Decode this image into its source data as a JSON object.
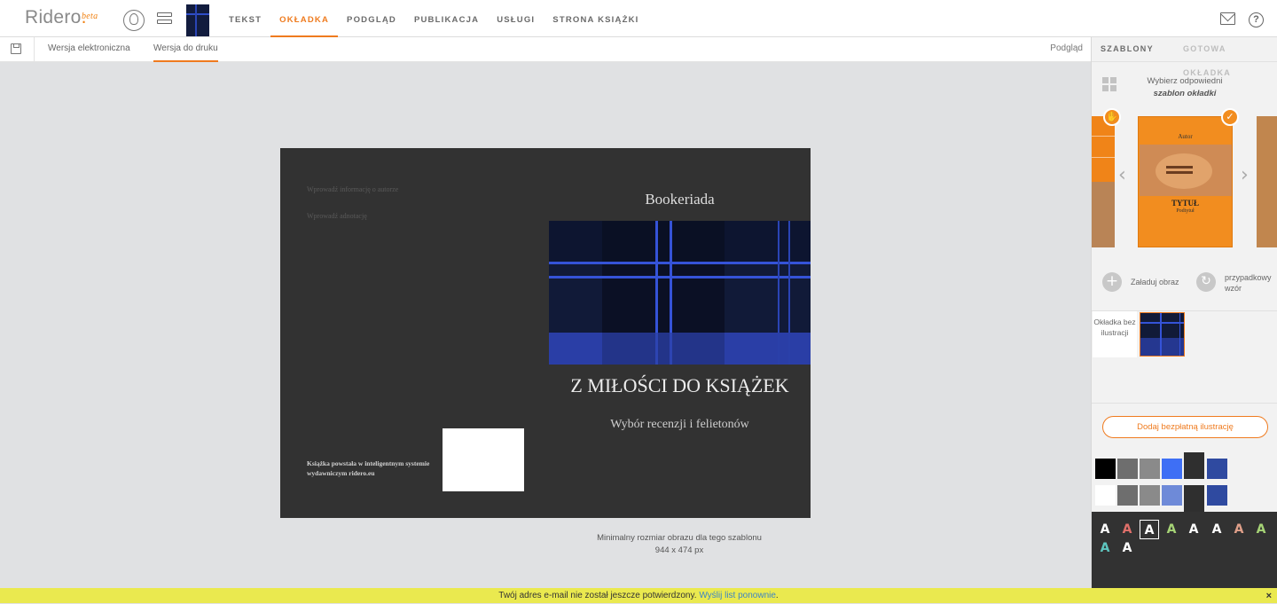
{
  "app": {
    "logo": "Ridero",
    "logo_dot": ".",
    "logo_badge": "beta"
  },
  "nav": {
    "items": [
      "TEKST",
      "OKŁADKA",
      "PODGLĄD",
      "PUBLIKACJA",
      "USŁUGI",
      "STRONA KSIĄŻKI"
    ],
    "active_index": 1
  },
  "subnav": {
    "tabs": [
      "Wersja elektroniczna",
      "Wersja do druku"
    ],
    "active_index": 1,
    "preview": "Podgląd"
  },
  "cover": {
    "author_info": "Wprowadź informację o autorze",
    "annotation": "Wprowadź adnotację",
    "imprint": "Książka powstała w inteligentnym systemie wydawniczym ridero.eu",
    "publisher": "Bookeriada",
    "title": "Z MIŁOŚCI DO KSIĄŻEK",
    "subtitle": "Wybór recenzji i felietonów"
  },
  "size_note": {
    "line1": "Minimalny rozmiar obrazu dla tego szablonu",
    "line2": "944 x 474 px"
  },
  "panel": {
    "tabs": [
      "SZABLONY",
      "GOTOWA OKŁADKA"
    ],
    "choose_line1": "Wybierz odpowiedni",
    "choose_line2": "szablon okładki",
    "template_author": "Autor",
    "template_title": "TYTUŁ",
    "template_subtitle": "Podtytuł",
    "upload": "Załaduj obraz",
    "random": "przypadkowy wzór",
    "no_illustration": "Okładka bez ilustracji",
    "add_illustration": "Dodaj bezpłatną ilustrację",
    "font_letter": "A"
  },
  "notice": {
    "text": "Twój adres e-mail nie został jeszcze potwierdzony.",
    "link": "Wyślij list ponownie",
    "end": ".",
    "close": "×"
  },
  "colors": {
    "accent": "#ef7b1f",
    "cover_bg": "#323232",
    "swatches_row1": [
      "#000000",
      "#6e6e6e",
      "#8a8a8a",
      "#3e6ff5",
      "#2f2f2f",
      "#2f4aa0"
    ],
    "swatches_row2": [
      "#ffffff",
      "#6e6e6e",
      "#8a8a8a",
      "#6e8ad8",
      "#2f2f2f",
      "#2f4aa0"
    ],
    "font_colors": [
      "#ffffff",
      "#e0706a",
      "#ffffff",
      "#a6d476",
      "#ffffff",
      "#ffffff",
      "#e0a08a",
      "#a6d476",
      "#5ec6c0",
      "#ffffff"
    ]
  }
}
